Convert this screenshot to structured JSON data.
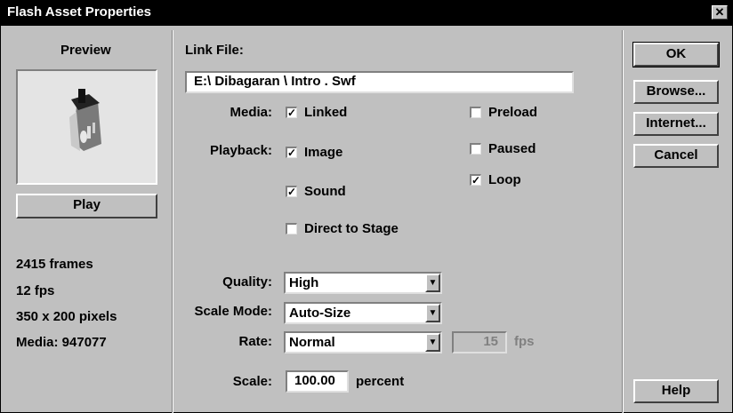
{
  "window": {
    "title": "Flash Asset Properties",
    "close_glyph": "✕"
  },
  "preview": {
    "label": "Preview",
    "play_label": "Play",
    "stats": [
      "2415 frames",
      "12 fps",
      "350 x 200 pixels",
      "Media: 947077"
    ]
  },
  "link": {
    "label": "Link File:",
    "value": "E:\\ Dibagaran \\ Intro . Swf"
  },
  "media": {
    "label": "Media:",
    "linked": {
      "label": "Linked",
      "checked": true
    },
    "preload": {
      "label": "Preload",
      "checked": false
    }
  },
  "playback": {
    "label": "Playback:",
    "image": {
      "label": "Image",
      "checked": true
    },
    "sound": {
      "label": "Sound",
      "checked": true
    },
    "direct": {
      "label": "Direct to Stage",
      "checked": false
    },
    "paused": {
      "label": "Paused",
      "checked": false
    },
    "loop": {
      "label": "Loop",
      "checked": true
    }
  },
  "quality": {
    "label": "Quality:",
    "value": "High"
  },
  "scale_mode": {
    "label": "Scale Mode:",
    "value": "Auto-Size"
  },
  "rate": {
    "label": "Rate:",
    "value": "Normal",
    "fps_value": "15",
    "fps_label": "fps"
  },
  "scale": {
    "label": "Scale:",
    "value": "100.00",
    "unit": "percent"
  },
  "buttons": {
    "ok": "OK",
    "browse": "Browse...",
    "internet": "Internet...",
    "cancel": "Cancel",
    "help": "Help"
  },
  "icons": {
    "checkbox_checked": "check-icon",
    "dropdown": "chevron-down-icon",
    "preview": "flash-preview-icon"
  }
}
